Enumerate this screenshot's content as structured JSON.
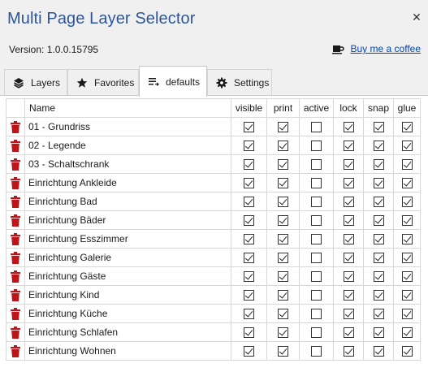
{
  "window": {
    "title": "Multi Page Layer Selector",
    "close_glyph": "✕"
  },
  "info": {
    "version": "Version: 1.0.0.15795",
    "coffee_icon": "coffee-cup-icon",
    "coffee_link": "Buy me a coffee"
  },
  "tabs": [
    {
      "label": "Layers",
      "icon": "layers-icon"
    },
    {
      "label": "Favorites",
      "icon": "star-icon"
    },
    {
      "label": "defaults",
      "icon": "list-icon",
      "active": true
    },
    {
      "label": "Settings",
      "icon": "gear-icon"
    }
  ],
  "columns": [
    "Name",
    "visible",
    "print",
    "active",
    "lock",
    "snap",
    "glue"
  ],
  "rows": [
    {
      "name": "01 - Grundriss",
      "visible": true,
      "print": true,
      "active": false,
      "lock": true,
      "snap": true,
      "glue": true
    },
    {
      "name": "02 - Legende",
      "visible": true,
      "print": true,
      "active": false,
      "lock": true,
      "snap": true,
      "glue": true
    },
    {
      "name": "03 - Schaltschrank",
      "visible": true,
      "print": true,
      "active": false,
      "lock": true,
      "snap": true,
      "glue": true
    },
    {
      "name": "Einrichtung Ankleide",
      "visible": true,
      "print": true,
      "active": false,
      "lock": true,
      "snap": true,
      "glue": true
    },
    {
      "name": "Einrichtung Bad",
      "visible": true,
      "print": true,
      "active": false,
      "lock": true,
      "snap": true,
      "glue": true
    },
    {
      "name": "Einrichtung Bäder",
      "visible": true,
      "print": true,
      "active": false,
      "lock": true,
      "snap": true,
      "glue": true
    },
    {
      "name": "Einrichtung Esszimmer",
      "visible": true,
      "print": true,
      "active": false,
      "lock": true,
      "snap": true,
      "glue": true
    },
    {
      "name": "Einrichtung Galerie",
      "visible": true,
      "print": true,
      "active": false,
      "lock": true,
      "snap": true,
      "glue": true
    },
    {
      "name": "Einrichtung Gäste",
      "visible": true,
      "print": true,
      "active": false,
      "lock": true,
      "snap": true,
      "glue": true
    },
    {
      "name": "Einrichtung Kind",
      "visible": true,
      "print": true,
      "active": false,
      "lock": true,
      "snap": true,
      "glue": true
    },
    {
      "name": "Einrichtung Küche",
      "visible": true,
      "print": true,
      "active": false,
      "lock": true,
      "snap": true,
      "glue": true
    },
    {
      "name": "Einrichtung Schlafen",
      "visible": true,
      "print": true,
      "active": false,
      "lock": true,
      "snap": true,
      "glue": true
    },
    {
      "name": "Einrichtung Wohnen",
      "visible": true,
      "print": true,
      "active": false,
      "lock": true,
      "snap": true,
      "glue": true
    }
  ],
  "colors": {
    "title": "#2b579a",
    "delete_icon": "#c0141b",
    "link": "#0645ad",
    "chrome": "#f0f0f0"
  }
}
